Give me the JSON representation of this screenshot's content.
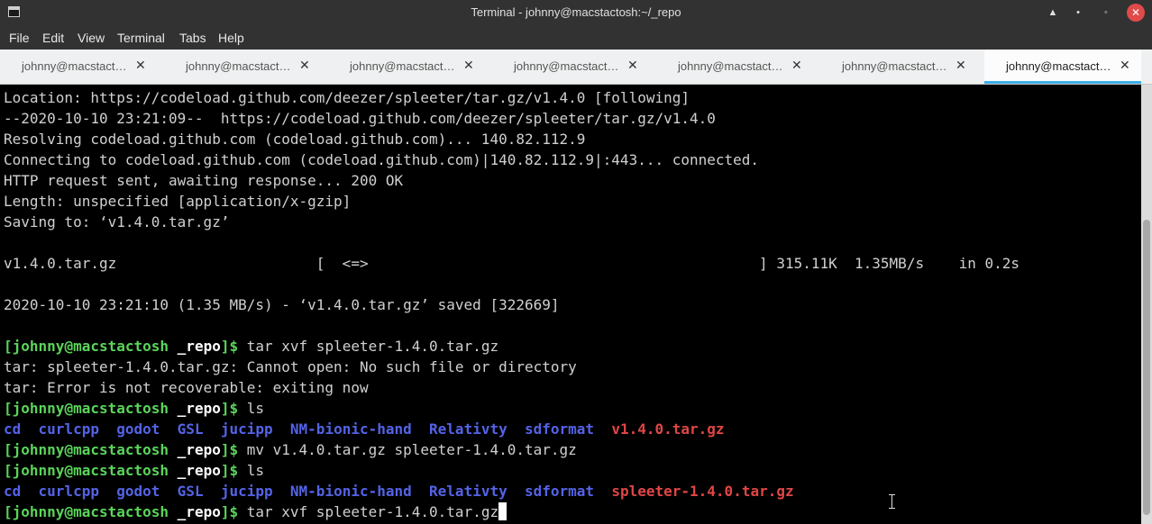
{
  "window": {
    "title": "Terminal - johnny@macstactosh:~/_repo",
    "buttons": {
      "keep_above": "▲",
      "minimize": "•",
      "maximize": "◦",
      "close": "✕"
    }
  },
  "menu": [
    "File",
    "Edit",
    "View",
    "Terminal",
    "Tabs",
    "Help"
  ],
  "tabs": [
    {
      "label": "johnny@macstact…",
      "close": "✕"
    },
    {
      "label": "johnny@macstact…",
      "close": "✕"
    },
    {
      "label": "johnny@macstact…",
      "close": "✕"
    },
    {
      "label": "johnny@macstact…",
      "close": "✕"
    },
    {
      "label": "johnny@macstact…",
      "close": "✕"
    },
    {
      "label": "johnny@macstact…",
      "close": "✕"
    },
    {
      "label": "johnny@macstact…",
      "close": "✕",
      "active": true
    }
  ],
  "terminal": {
    "prompt": {
      "bracket_open": "[",
      "user_host": "johnny@macstactosh",
      "dir": "_repo",
      "bracket_close": "]$"
    },
    "lines": [
      "Location: https://codeload.github.com/deezer/spleeter/tar.gz/v1.4.0 [following]",
      "--2020-10-10 23:21:09--  https://codeload.github.com/deezer/spleeter/tar.gz/v1.4.0",
      "Resolving codeload.github.com (codeload.github.com)... 140.82.112.9",
      "Connecting to codeload.github.com (codeload.github.com)|140.82.112.9|:443... connected.",
      "HTTP request sent, awaiting response... 200 OK",
      "Length: unspecified [application/x-gzip]",
      "Saving to: ‘v1.4.0.tar.gz’",
      "v1.4.0.tar.gz                       [  <=>                                             ] 315.11K  1.35MB/s    in 0.2s",
      "2020-10-10 23:21:10 (1.35 MB/s) - ‘v1.4.0.tar.gz’ saved [322669]",
      "tar: spleeter-1.4.0.tar.gz: Cannot open: No such file or directory",
      "tar: Error is not recoverable: exiting now"
    ],
    "commands": [
      " tar xvf spleeter-1.4.0.tar.gz",
      " ls",
      " mv v1.4.0.tar.gz spleeter-1.4.0.tar.gz",
      " ls",
      " tar xvf spleeter-1.4.0.tar.gz"
    ],
    "dirs": [
      "cd",
      "curlcpp",
      "godot",
      "GSL",
      "jucipp",
      "NM-bionic-hand",
      "Relativty",
      "sdformat"
    ],
    "archive_1": "v1.4.0.tar.gz",
    "archive_2": "spleeter-1.4.0.tar.gz"
  }
}
